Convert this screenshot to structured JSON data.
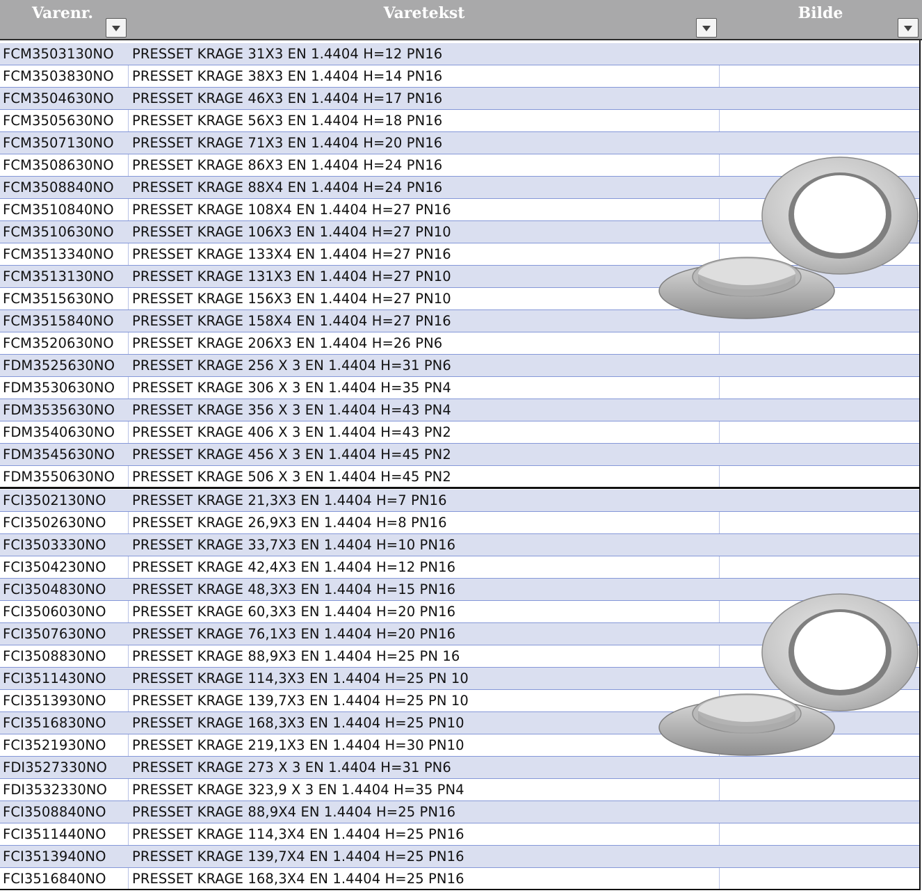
{
  "header": {
    "col_item_no": "Varenr.",
    "col_description": "Varetekst",
    "col_image": "Bilde"
  },
  "group1": [
    {
      "item_no": "FCM3503130NO",
      "description": "PRESSET KRAGE 31X3 EN 1.4404 H=12 PN16"
    },
    {
      "item_no": "FCM3503830NO",
      "description": "PRESSET KRAGE 38X3 EN 1.4404 H=14 PN16"
    },
    {
      "item_no": "FCM3504630NO",
      "description": "PRESSET KRAGE 46X3 EN 1.4404 H=17 PN16"
    },
    {
      "item_no": "FCM3505630NO",
      "description": "PRESSET KRAGE 56X3 EN 1.4404 H=18 PN16"
    },
    {
      "item_no": "FCM3507130NO",
      "description": "PRESSET KRAGE 71X3 EN 1.4404 H=20 PN16"
    },
    {
      "item_no": "FCM3508630NO",
      "description": "PRESSET KRAGE 86X3 EN 1.4404 H=24 PN16"
    },
    {
      "item_no": "FCM3508840NO",
      "description": "PRESSET KRAGE 88X4 EN 1.4404 H=24 PN16"
    },
    {
      "item_no": "FCM3510840NO",
      "description": "PRESSET KRAGE 108X4 EN 1.4404 H=27 PN16"
    },
    {
      "item_no": "FCM3510630NO",
      "description": "PRESSET KRAGE 106X3 EN 1.4404 H=27 PN10"
    },
    {
      "item_no": "FCM3513340NO",
      "description": "PRESSET KRAGE 133X4 EN 1.4404 H=27 PN16"
    },
    {
      "item_no": "FCM3513130NO",
      "description": "PRESSET KRAGE 131X3 EN 1.4404 H=27 PN10"
    },
    {
      "item_no": "FCM3515630NO",
      "description": "PRESSET KRAGE 156X3 EN 1.4404 H=27 PN10"
    },
    {
      "item_no": "FCM3515840NO",
      "description": "PRESSET KRAGE 158X4 EN 1.4404 H=27 PN16"
    },
    {
      "item_no": "FCM3520630NO",
      "description": "PRESSET KRAGE 206X3 EN 1.4404 H=26 PN6"
    },
    {
      "item_no": "FDM3525630NO",
      "description": "PRESSET KRAGE 256 X 3 EN 1.4404 H=31 PN6"
    },
    {
      "item_no": "FDM3530630NO",
      "description": "PRESSET KRAGE 306 X 3 EN 1.4404 H=35 PN4"
    },
    {
      "item_no": "FDM3535630NO",
      "description": "PRESSET KRAGE 356 X 3 EN 1.4404 H=43 PN4"
    },
    {
      "item_no": "FDM3540630NO",
      "description": "PRESSET KRAGE 406 X 3 EN 1.4404 H=43 PN2"
    },
    {
      "item_no": "FDM3545630NO",
      "description": "PRESSET KRAGE 456 X 3 EN 1.4404 H=45 PN2"
    },
    {
      "item_no": "FDM3550630NO",
      "description": "PRESSET KRAGE 506 X 3 EN 1.4404 H=45 PN2"
    }
  ],
  "group2": [
    {
      "item_no": "FCI3502130NO",
      "description": "PRESSET KRAGE 21,3X3 EN 1.4404 H=7 PN16"
    },
    {
      "item_no": "FCI3502630NO",
      "description": "PRESSET KRAGE 26,9X3 EN 1.4404 H=8 PN16"
    },
    {
      "item_no": "FCI3503330NO",
      "description": "PRESSET KRAGE 33,7X3 EN 1.4404 H=10 PN16"
    },
    {
      "item_no": "FCI3504230NO",
      "description": "PRESSET KRAGE 42,4X3 EN 1.4404 H=12 PN16"
    },
    {
      "item_no": "FCI3504830NO",
      "description": "PRESSET KRAGE 48,3X3 EN 1.4404 H=15 PN16"
    },
    {
      "item_no": "FCI3506030NO",
      "description": "PRESSET KRAGE 60,3X3 EN 1.4404 H=20 PN16"
    },
    {
      "item_no": "FCI3507630NO",
      "description": "PRESSET KRAGE 76,1X3 EN 1.4404 H=20 PN16"
    },
    {
      "item_no": "FCI3508830NO",
      "description": "PRESSET KRAGE 88,9X3 EN 1.4404 H=25 PN 16"
    },
    {
      "item_no": "FCI3511430NO",
      "description": "PRESSET KRAGE 114,3X3 EN 1.4404 H=25 PN 10"
    },
    {
      "item_no": "FCI3513930NO",
      "description": "PRESSET KRAGE 139,7X3 EN 1.4404 H=25 PN 10"
    },
    {
      "item_no": "FCI3516830NO",
      "description": "PRESSET KRAGE 168,3X3 EN 1.4404 H=25 PN10"
    },
    {
      "item_no": "FCI3521930NO",
      "description": "PRESSET KRAGE 219,1X3 EN 1.4404 H=30 PN10"
    },
    {
      "item_no": "FDI3527330NO",
      "description": "PRESSET KRAGE 273 X 3 EN 1.4404 H=31 PN6"
    },
    {
      "item_no": "FDI3532330NO",
      "description": "PRESSET KRAGE 323,9 X 3 EN 1.4404 H=35 PN4"
    },
    {
      "item_no": "FCI3508840NO",
      "description": "PRESSET KRAGE 88,9X4 EN 1.4404 H=25 PN16"
    },
    {
      "item_no": "FCI3511440NO",
      "description": "PRESSET KRAGE 114,3X4 EN 1.4404 H=25 PN16"
    },
    {
      "item_no": "FCI3513940NO",
      "description": "PRESSET KRAGE 139,7X4 EN 1.4404 H=25 PN16"
    },
    {
      "item_no": "FCI3516840NO",
      "description": "PRESSET KRAGE 168,3X4 EN 1.4404 H=25 PN16"
    }
  ],
  "colors": {
    "header_bg": "#a9a9aa",
    "band_row": "#dadff0",
    "row_rule": "#8497d8"
  },
  "icons": {
    "filter": "dropdown-filter-icon",
    "product_image": "collar-flange-photo"
  }
}
